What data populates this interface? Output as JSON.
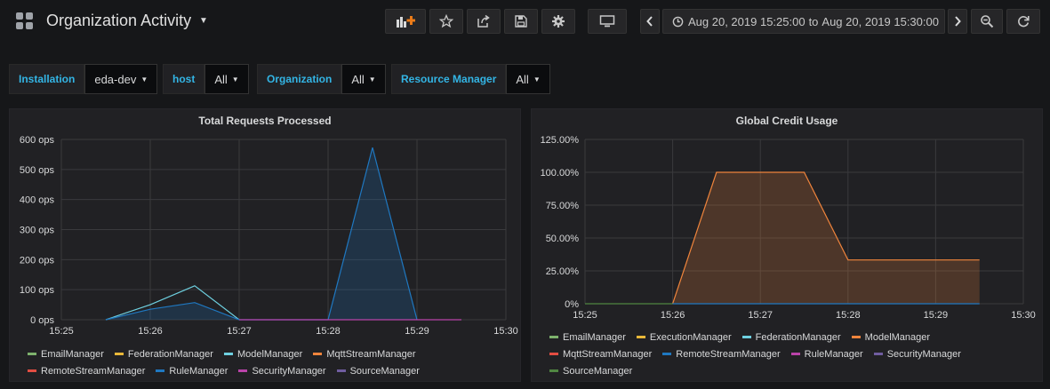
{
  "header": {
    "title": "Organization Activity",
    "icons": [
      "grid-icon",
      "add-panel-icon",
      "star-icon",
      "share-icon",
      "save-icon",
      "gear-icon",
      "tv-mode-icon",
      "chevron-left-icon",
      "clock-icon",
      "chevron-right-icon",
      "zoom-out-icon",
      "refresh-icon"
    ],
    "time_from": "Aug 20, 2019 15:25:00",
    "time_to_word": "to",
    "time_to": "Aug 20, 2019 15:30:00"
  },
  "variables": [
    {
      "label": "Installation",
      "value": "eda-dev"
    },
    {
      "label": "host",
      "value": "All"
    },
    {
      "label": "Organization",
      "value": "All"
    },
    {
      "label": "Resource Manager",
      "value": "All"
    }
  ],
  "colors": {
    "accent": "#33b5e5",
    "grid": "#3a3a3d"
  },
  "panels": {
    "requests": {
      "title": "Total Requests Processed"
    },
    "credit": {
      "title": "Global Credit Usage"
    }
  },
  "chart_data": [
    {
      "type": "area",
      "title": "Total Requests Processed",
      "x_ticks": [
        "15:25",
        "15:26",
        "15:27",
        "15:28",
        "15:29",
        "15:30"
      ],
      "y_ticks": [
        "0 ops",
        "100 ops",
        "200 ops",
        "300 ops",
        "400 ops",
        "500 ops",
        "600 ops"
      ],
      "ylim": [
        0,
        600
      ],
      "xlim_minutes": [
        0,
        5
      ],
      "grid": true,
      "legend_position": "bottom",
      "legend": [
        "EmailManager",
        "FederationManager",
        "ModelManager",
        "MqttStreamManager",
        "RemoteStreamManager",
        "RuleManager",
        "SecurityManager",
        "SourceManager"
      ],
      "legend_colors": [
        "#7eb26d",
        "#eab839",
        "#6ed0e0",
        "#ef843c",
        "#e24d42",
        "#1f78c1",
        "#ba43a9",
        "#705da0"
      ],
      "series": [
        {
          "name": "ModelManager",
          "color": "#6ed0e0",
          "fill": false,
          "x": [
            0.5,
            1,
            1.5,
            2
          ],
          "values": [
            0,
            50,
            113,
            0
          ]
        },
        {
          "name": "RuleManager",
          "color": "#1f78c1",
          "fill": true,
          "x": [
            0.5,
            1,
            1.5,
            2,
            3,
            3.5,
            4
          ],
          "values": [
            0,
            35,
            57,
            0,
            0,
            573,
            0
          ]
        },
        {
          "name": "SecurityManager",
          "color": "#ba43a9",
          "fill": false,
          "x": [
            2,
            4.5
          ],
          "values": [
            0,
            0
          ]
        }
      ]
    },
    {
      "type": "area",
      "title": "Global Credit Usage",
      "x_ticks": [
        "15:25",
        "15:26",
        "15:27",
        "15:28",
        "15:29",
        "15:30"
      ],
      "y_ticks": [
        "0%",
        "25.00%",
        "50.00%",
        "75.00%",
        "100.00%",
        "125.00%"
      ],
      "ylim": [
        0,
        125
      ],
      "xlim_minutes": [
        0,
        5
      ],
      "grid": true,
      "legend_position": "bottom",
      "legend": [
        "EmailManager",
        "ExecutionManager",
        "FederationManager",
        "ModelManager",
        "MqttStreamManager",
        "RemoteStreamManager",
        "RuleManager",
        "SecurityManager",
        "SourceManager"
      ],
      "legend_colors": [
        "#7eb26d",
        "#eab839",
        "#6ed0e0",
        "#ef843c",
        "#e24d42",
        "#1f78c1",
        "#ba43a9",
        "#705da0",
        "#508642"
      ],
      "series": [
        {
          "name": "ModelManager",
          "color": "#ef843c",
          "fill": true,
          "x": [
            1,
            1.5,
            2.5,
            3,
            4.5
          ],
          "values": [
            0,
            100,
            100,
            33.3,
            33.3
          ]
        },
        {
          "name": "SourceManager",
          "color": "#508642",
          "fill": false,
          "x": [
            0,
            1
          ],
          "values": [
            0,
            0
          ]
        },
        {
          "name": "RemoteStreamManager",
          "color": "#1f78c1",
          "fill": false,
          "x": [
            1,
            4.5
          ],
          "values": [
            0,
            0
          ]
        }
      ]
    }
  ]
}
